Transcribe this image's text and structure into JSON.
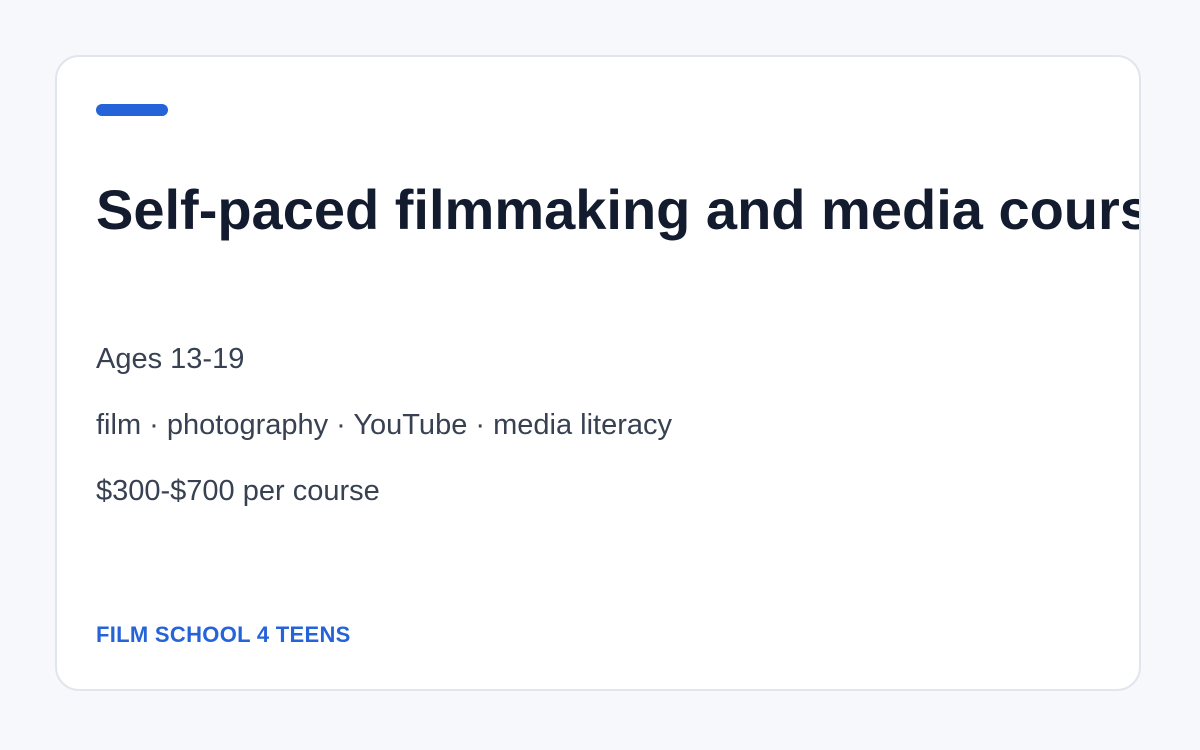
{
  "card": {
    "title": "Self-paced filmmaking and media courses",
    "ages": "Ages 13-19",
    "topics": "film · photography · YouTube · media literacy",
    "price": "$300-$700 per course",
    "brand": "FILM SCHOOL 4 TEENS"
  },
  "colors": {
    "accent": "#2563d9",
    "title": "#131b2e",
    "body_text": "#374152",
    "card_border": "#e1e5ee",
    "page_background": "#f7f8fb"
  }
}
